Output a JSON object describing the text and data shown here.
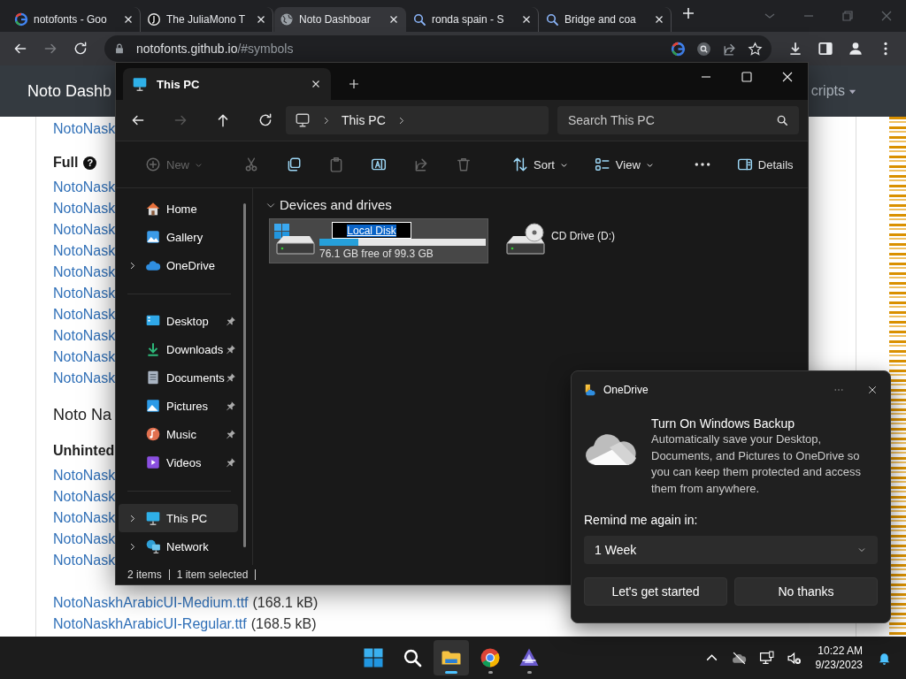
{
  "browser": {
    "tabs": [
      {
        "title": "notofonts - Goo",
        "kind": "g",
        "selected": false
      },
      {
        "title": "The JuliaMono T",
        "kind": "dark",
        "selected": false
      },
      {
        "title": "Noto Dashboar",
        "kind": "globe",
        "selected": true
      },
      {
        "title": "ronda spain - S",
        "kind": "search",
        "selected": false
      },
      {
        "title": "Bridge and coa",
        "kind": "search",
        "selected": false
      }
    ],
    "nav": [
      {
        "kind": "back",
        "disabled": false
      },
      {
        "kind": "forward",
        "disabled": true
      },
      {
        "kind": "reload",
        "disabled": false
      }
    ],
    "url_host": "notofonts.github.io",
    "url_path": "/#symbols"
  },
  "page": {
    "header_title": "Noto Dashb",
    "header_menu": "cripts",
    "blocks": [
      {
        "kind": "link",
        "text": "NotoNask"
      },
      {
        "kind": "heading",
        "text": "Full",
        "help": "?"
      },
      {
        "kind": "link",
        "text": "NotoNask"
      },
      {
        "kind": "link",
        "text": "NotoNask"
      },
      {
        "kind": "link",
        "text": "NotoNask"
      },
      {
        "kind": "link",
        "text": "NotoNask"
      },
      {
        "kind": "link",
        "text": "NotoNask"
      },
      {
        "kind": "link",
        "text": "NotoNask"
      },
      {
        "kind": "link",
        "text": "NotoNask"
      },
      {
        "kind": "link",
        "text": "NotoNask"
      },
      {
        "kind": "link",
        "text": "NotoNask"
      },
      {
        "kind": "link",
        "text": "NotoNask"
      },
      {
        "kind": "title",
        "text": "Noto Na"
      },
      {
        "kind": "heading",
        "text": "Unhinted"
      },
      {
        "kind": "link",
        "text": "NotoNask"
      },
      {
        "kind": "link",
        "text": "NotoNask"
      },
      {
        "kind": "link",
        "text": "NotoNask"
      },
      {
        "kind": "link",
        "text": "NotoNask"
      },
      {
        "kind": "link",
        "text": "NotoNask"
      }
    ],
    "files_below": [
      {
        "file": "NotoNaskhArabicUI-Medium.ttf",
        "size": "(168.1 kB)"
      },
      {
        "file": "NotoNaskhArabicUI-Regular.ttf",
        "size": "(168.5 kB)"
      }
    ]
  },
  "explorer": {
    "tab_title": "This PC",
    "nav": [
      {
        "kind": "back",
        "disabled": false
      },
      {
        "kind": "forward",
        "disabled": true
      },
      {
        "kind": "up",
        "disabled": false
      },
      {
        "kind": "refresh",
        "disabled": false
      }
    ],
    "breadcrumb": "This PC",
    "search_placeholder": "Search This PC",
    "command_groups": [
      [
        {
          "kind": "new",
          "label": "New",
          "disabled": true,
          "menu": true
        }
      ],
      [
        {
          "kind": "cut",
          "disabled": true
        },
        {
          "kind": "copy",
          "disabled": false
        },
        {
          "kind": "paste",
          "disabled": true
        },
        {
          "kind": "rename",
          "disabled": false
        },
        {
          "kind": "share",
          "disabled": true
        },
        {
          "kind": "delete",
          "disabled": true
        }
      ],
      [
        {
          "kind": "sort",
          "label": "Sort",
          "disabled": false,
          "menu": true
        },
        {
          "kind": "view",
          "label": "View",
          "disabled": false,
          "menu": true
        }
      ],
      [
        {
          "kind": "more",
          "disabled": false
        }
      ]
    ],
    "details_label": "Details",
    "sidebar": [
      [
        {
          "label": "Home",
          "kind": "home",
          "expandable": false,
          "pinned": false,
          "selected": false
        },
        {
          "label": "Gallery",
          "kind": "gallery",
          "expandable": false,
          "pinned": false,
          "selected": false
        },
        {
          "label": "OneDrive",
          "kind": "onedrive",
          "expandable": true,
          "pinned": false,
          "selected": false
        }
      ],
      [
        {
          "label": "Desktop",
          "kind": "desktop",
          "expandable": false,
          "pinned": true,
          "selected": false
        },
        {
          "label": "Downloads",
          "kind": "downloads",
          "expandable": false,
          "pinned": true,
          "selected": false
        },
        {
          "label": "Documents",
          "kind": "documents",
          "expandable": false,
          "pinned": true,
          "selected": false
        },
        {
          "label": "Pictures",
          "kind": "pictures",
          "expandable": false,
          "pinned": true,
          "selected": false
        },
        {
          "label": "Music",
          "kind": "music",
          "expandable": false,
          "pinned": true,
          "selected": false
        },
        {
          "label": "Videos",
          "kind": "videos",
          "expandable": false,
          "pinned": true,
          "selected": false
        }
      ],
      [
        {
          "label": "This PC",
          "kind": "thispc",
          "expandable": true,
          "pinned": false,
          "selected": true
        },
        {
          "label": "Network",
          "kind": "network",
          "expandable": true,
          "pinned": false,
          "selected": false
        }
      ]
    ],
    "group_title": "Devices and drives",
    "drives": [
      {
        "kind": "disk",
        "name": "Local Disk",
        "editing": true,
        "selected": true,
        "level": 0.234,
        "free": "76.1 GB free of 99.3 GB"
      },
      {
        "kind": "cd",
        "name": "CD Drive (D:)",
        "editing": false,
        "selected": false
      }
    ],
    "status_items": "2 items",
    "status_selected": "1 item selected"
  },
  "popup": {
    "app": "OneDrive",
    "title": "Turn On Windows Backup",
    "body": "Automatically save your Desktop, Documents, and Pictures to OneDrive so you can keep them protected and access them from anywhere.",
    "remind_label": "Remind me again in:",
    "remind_value": "1 Week",
    "buttons": [
      "Let's get started",
      "No thanks"
    ]
  },
  "taskbar": {
    "apps": [
      {
        "kind": "start",
        "active": false,
        "running": false
      },
      {
        "kind": "search",
        "active": false,
        "running": false
      },
      {
        "kind": "explorer",
        "active": true,
        "running": true
      },
      {
        "kind": "chrome",
        "active": false,
        "running": true
      },
      {
        "kind": "app",
        "active": false,
        "running": true
      }
    ],
    "time": "10:22 AM",
    "date": "9/23/2023"
  }
}
